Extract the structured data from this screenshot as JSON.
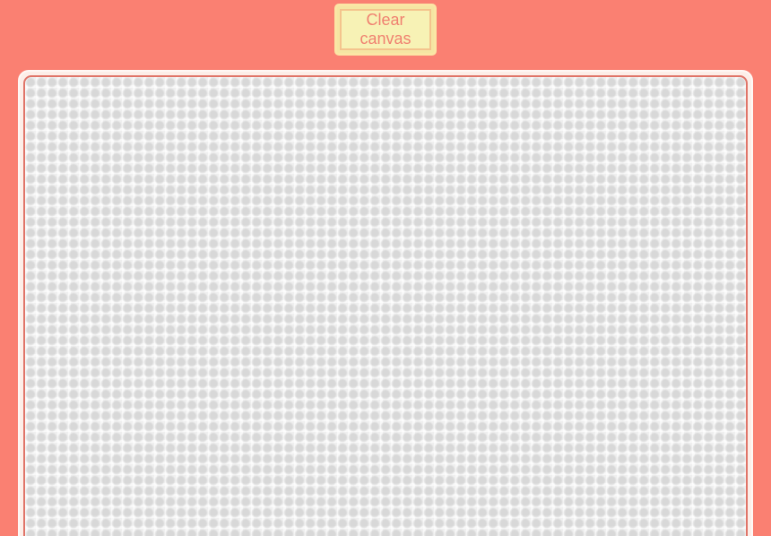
{
  "toolbar": {
    "clear_label": "Clear canvas"
  },
  "colors": {
    "background": "#fa8072",
    "button_fill": "#f7f2b5",
    "button_border": "#f4c48d",
    "button_text": "#f08070",
    "canvas_border": "#e07468",
    "canvas_fill": "#efefef"
  },
  "icons": []
}
